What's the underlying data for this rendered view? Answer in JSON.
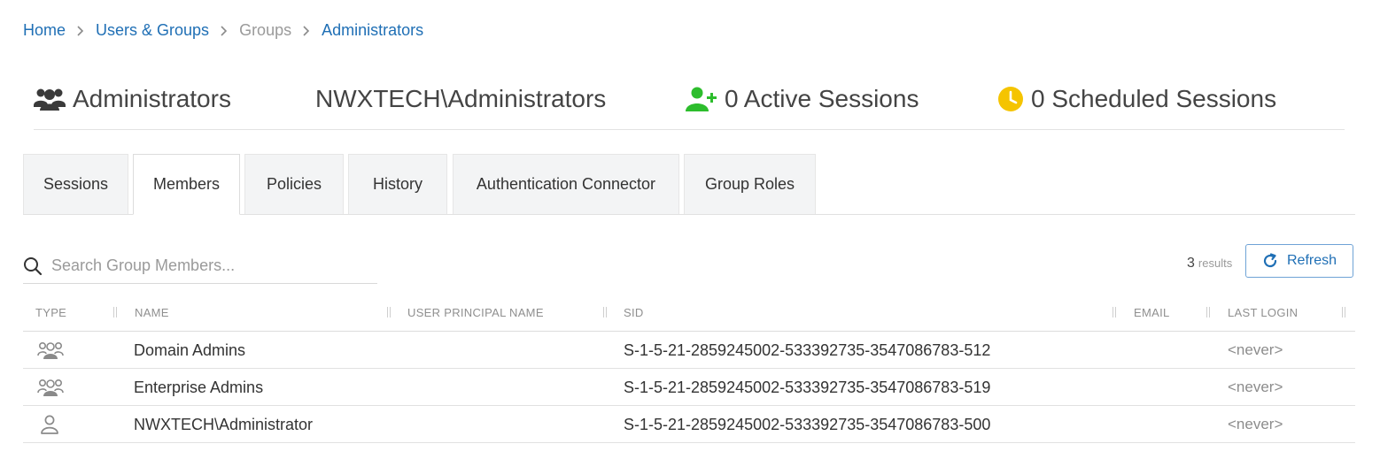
{
  "breadcrumb": [
    {
      "label": "Home",
      "link": true
    },
    {
      "label": "Users & Groups",
      "link": true
    },
    {
      "label": "Groups",
      "link": false
    },
    {
      "label": "Administrators",
      "link": true
    }
  ],
  "header": {
    "group_name": "Administrators",
    "domain_name": "NWXTECH\\Administrators",
    "active_sessions": "0 Active Sessions",
    "scheduled_sessions": "0 Scheduled Sessions",
    "icons": {
      "group": "users-group-icon",
      "active": "user-plus-icon",
      "scheduled": "clock-icon"
    },
    "colors": {
      "active": "#2dbd2d",
      "scheduled": "#f5c400"
    }
  },
  "tabs": [
    {
      "label": "Sessions",
      "active": false
    },
    {
      "label": "Members",
      "active": true
    },
    {
      "label": "Policies",
      "active": false
    },
    {
      "label": "History",
      "active": false
    },
    {
      "label": "Authentication Connector",
      "active": false
    },
    {
      "label": "Group Roles",
      "active": false
    }
  ],
  "search": {
    "placeholder": "Search Group Members...",
    "value": ""
  },
  "results": {
    "count": "3",
    "label": "results"
  },
  "refresh": {
    "label": "Refresh"
  },
  "table": {
    "columns": [
      "TYPE",
      "NAME",
      "USER PRINCIPAL NAME",
      "SID",
      "EMAIL",
      "LAST LOGIN"
    ],
    "rows": [
      {
        "type": "group",
        "name": "Domain Admins",
        "upn": "",
        "sid": "S-1-5-21-2859245002-533392735-3547086783-512",
        "email": "",
        "last_login": "<never>"
      },
      {
        "type": "group",
        "name": "Enterprise Admins",
        "upn": "",
        "sid": "S-1-5-21-2859245002-533392735-3547086783-519",
        "email": "",
        "last_login": "<never>"
      },
      {
        "type": "user",
        "name": "NWXTECH\\Administrator",
        "upn": "",
        "sid": "S-1-5-21-2859245002-533392735-3547086783-500",
        "email": "",
        "last_login": "<never>"
      }
    ]
  },
  "colors": {
    "link": "#1f6fb5",
    "accent_border": "#6fa3d6"
  }
}
